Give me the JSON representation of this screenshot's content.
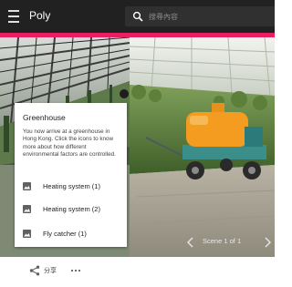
{
  "topbar": {
    "brand": "Poly",
    "search": {
      "placeholder": "搜尋內容"
    },
    "accent_color": "#e91e63",
    "icons": [
      "menu-icon",
      "search-icon"
    ]
  },
  "viewer": {
    "info_card": {
      "title": "Greenhouse",
      "description": "You now arrive at a greenhouse in Hong Kong. Click the icons to know more about how different environmental factors are controlled.",
      "items": [
        {
          "label": "Heating system (1)",
          "icon": "image-icon"
        },
        {
          "label": "Heating system (2)",
          "icon": "image-icon"
        },
        {
          "label": "Fly catcher (1)",
          "icon": "image-icon"
        }
      ]
    },
    "scene_counter": "Scene 1 of 1",
    "nav_icons": [
      "chevron-left-icon",
      "chevron-right-icon"
    ]
  },
  "bottombar": {
    "share_label": "分享",
    "icons": [
      "share-icon",
      "more-horizontal-icon"
    ]
  }
}
